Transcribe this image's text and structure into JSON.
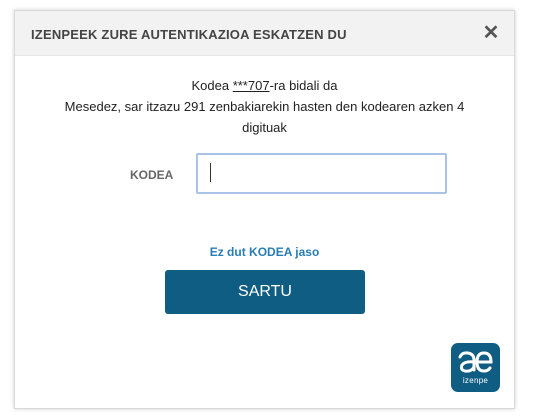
{
  "dialog": {
    "title": "IZENPEEK ZURE AUTENTIKAZIOA ESKATZEN DU",
    "close_label": "✕"
  },
  "message": {
    "line1_prefix": "Kodea ",
    "masked_number": "***707",
    "line1_suffix": "-ra bidali da",
    "line2": "Mesedez, sar itzazu 291 zenbakiarekin hasten den kodearen azken 4",
    "line3": "digituak"
  },
  "form": {
    "code_label": "KODEA",
    "code_value": "",
    "no_code_link": "Ez dut KODEA jaso",
    "submit_label": "SARTU"
  },
  "branding": {
    "logo_text": "izenpe",
    "logo_icon": "izenpe-logo-icon",
    "accent_color": "#0f5d82",
    "link_color": "#2a7db3"
  }
}
